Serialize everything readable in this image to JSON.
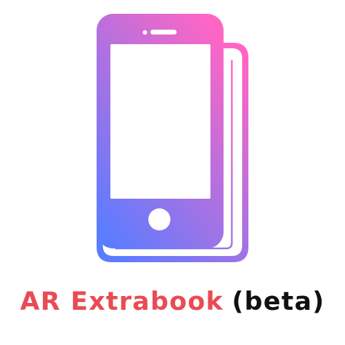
{
  "logo": {
    "icon": "phone-book-icon",
    "gradient_top": "#ff66c4",
    "gradient_bottom": "#5c7cff"
  },
  "brand": {
    "name": "AR Extrabook",
    "badge": "(beta)",
    "name_color": "#e94b55",
    "badge_color": "#111111"
  }
}
